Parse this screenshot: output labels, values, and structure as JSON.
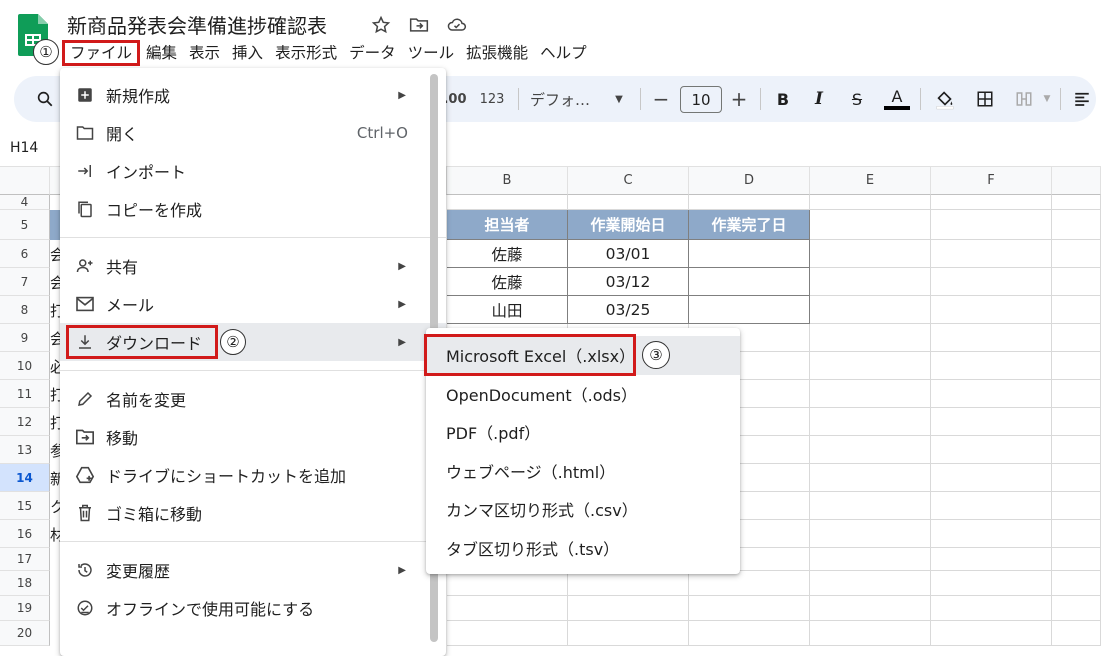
{
  "doc": {
    "title": "新商品発表会準備進捗確認表",
    "star_icon": "star-icon",
    "move_icon": "folder-move-icon",
    "cloud_icon": "cloud-status-icon"
  },
  "menubar": [
    "ファイル",
    "編集",
    "表示",
    "挿入",
    "表示形式",
    "データ",
    "ツール",
    "拡張機能",
    "ヘルプ"
  ],
  "markers": {
    "one": "①",
    "two": "②",
    "three": "③"
  },
  "toolbar": {
    "number_format": "123",
    "font": "デフォ…",
    "font_size": "10",
    "minus": "−",
    "plus": "+",
    "bold": "B",
    "italic": "I",
    "strike": "S",
    "textcolor": "A"
  },
  "namebox": "H14",
  "columns": [
    "B",
    "C",
    "D",
    "E",
    "F"
  ],
  "rows": [
    "4",
    "5",
    "6",
    "7",
    "8",
    "9",
    "10",
    "11",
    "12",
    "13",
    "14",
    "15",
    "16",
    "17",
    "18",
    "19",
    "20"
  ],
  "selected_row": "14",
  "table": {
    "headers": [
      "担当者",
      "作業開始日",
      "作業完了日"
    ],
    "rows": [
      [
        "佐藤",
        "03/01",
        ""
      ],
      [
        "佐藤",
        "03/12",
        ""
      ],
      [
        "山田",
        "03/25",
        ""
      ]
    ]
  },
  "col_a_glimpse": [
    "",
    "",
    "会",
    "会",
    "打",
    "会",
    "必",
    "打",
    "打",
    "参",
    "新",
    "ク",
    "材",
    "",
    "",
    "",
    ""
  ],
  "file_menu": {
    "items": [
      {
        "label": "新規作成",
        "icon": "new-doc-icon",
        "submenu": true
      },
      {
        "label": "開く",
        "icon": "folder-open-icon",
        "shortcut": "Ctrl+O"
      },
      {
        "label": "インポート",
        "icon": "import-icon"
      },
      {
        "label": "コピーを作成",
        "icon": "copy-icon"
      },
      {
        "label": "共有",
        "icon": "share-person-icon",
        "submenu": true
      },
      {
        "label": "メール",
        "icon": "mail-icon",
        "submenu": true
      },
      {
        "label": "ダウンロード",
        "icon": "download-icon",
        "submenu": true
      },
      {
        "label": "名前を変更",
        "icon": "pencil-icon"
      },
      {
        "label": "移動",
        "icon": "folder-move-icon"
      },
      {
        "label": "ドライブにショートカットを追加",
        "icon": "drive-shortcut-icon"
      },
      {
        "label": "ゴミ箱に移動",
        "icon": "trash-icon"
      },
      {
        "label": "変更履歴",
        "icon": "history-icon",
        "submenu": true
      },
      {
        "label": "オフラインで使用可能にする",
        "icon": "offline-check-icon"
      }
    ]
  },
  "download_submenu": [
    "Microsoft Excel（.xlsx）",
    "OpenDocument（.ods）",
    "PDF（.pdf）",
    "ウェブページ（.html）",
    "カンマ区切り形式（.csv）",
    "タブ区切り形式（.tsv）"
  ],
  "colors": {
    "accent_red": "#d11a1a",
    "header_fill": "#8ea9c9",
    "toolbar_bg": "#edf2fa",
    "logo_green": "#0f9d58"
  }
}
